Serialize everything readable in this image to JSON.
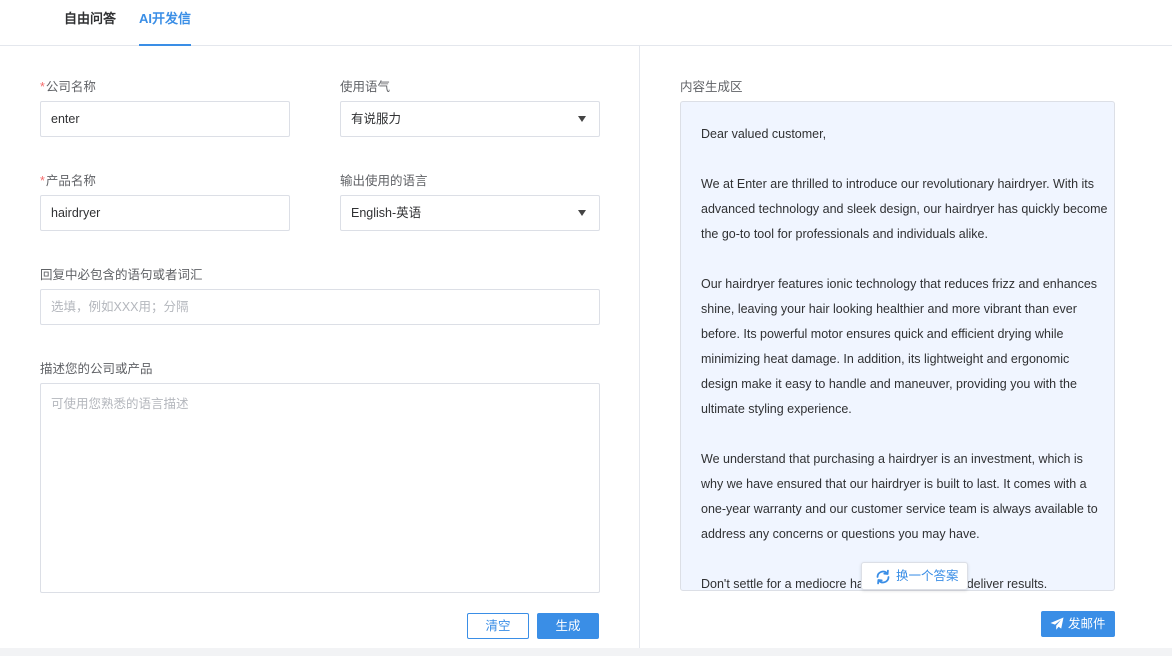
{
  "tabs": [
    {
      "label": "自由问答"
    },
    {
      "label": "AI开发信"
    }
  ],
  "form": {
    "required_mark": "*",
    "company": {
      "label": "公司名称",
      "value": "enter"
    },
    "tone": {
      "label": "使用语气",
      "value": "有说服力"
    },
    "product": {
      "label": "产品名称",
      "value": "hairdryer"
    },
    "language": {
      "label": "输出使用的语言",
      "value": "English-英语"
    },
    "keywords": {
      "label": "回复中必包含的语句或者词汇",
      "placeholder": "选填，例如XXX用；分隔"
    },
    "description": {
      "label": "描述您的公司或产品",
      "placeholder": "可使用您熟悉的语言描述"
    },
    "clear_label": "清空",
    "generate_label": "生成"
  },
  "result": {
    "label": "内容生成区",
    "paragraphs": [
      "Dear valued customer,",
      "We at Enter are thrilled to introduce our revolutionary hairdryer. With its advanced technology and sleek design, our hairdryer has quickly become the go-to tool for professionals and individuals alike.",
      "Our hairdryer features ionic technology that reduces frizz and enhances shine, leaving your hair looking healthier and more vibrant than ever before. Its powerful motor ensures quick and efficient drying while minimizing heat damage. In addition, its lightweight and ergonomic design make it easy to handle and maneuver, providing you with the ultimate styling experience.",
      "We understand that purchasing a hairdryer is an investment, which is why we have ensured that our hairdryer is built to last. It comes with a one-year warranty and our customer service team is always available to address any concerns or questions you may have.",
      "Don't settle for a mediocre hairdryer that fails to deliver results."
    ],
    "regenerate_label": "换一个答案",
    "send_label": "发邮件"
  },
  "colors": {
    "accent": "#3a8ee6",
    "required": "#f56c6c",
    "result_bg": "#f0f5ff"
  }
}
